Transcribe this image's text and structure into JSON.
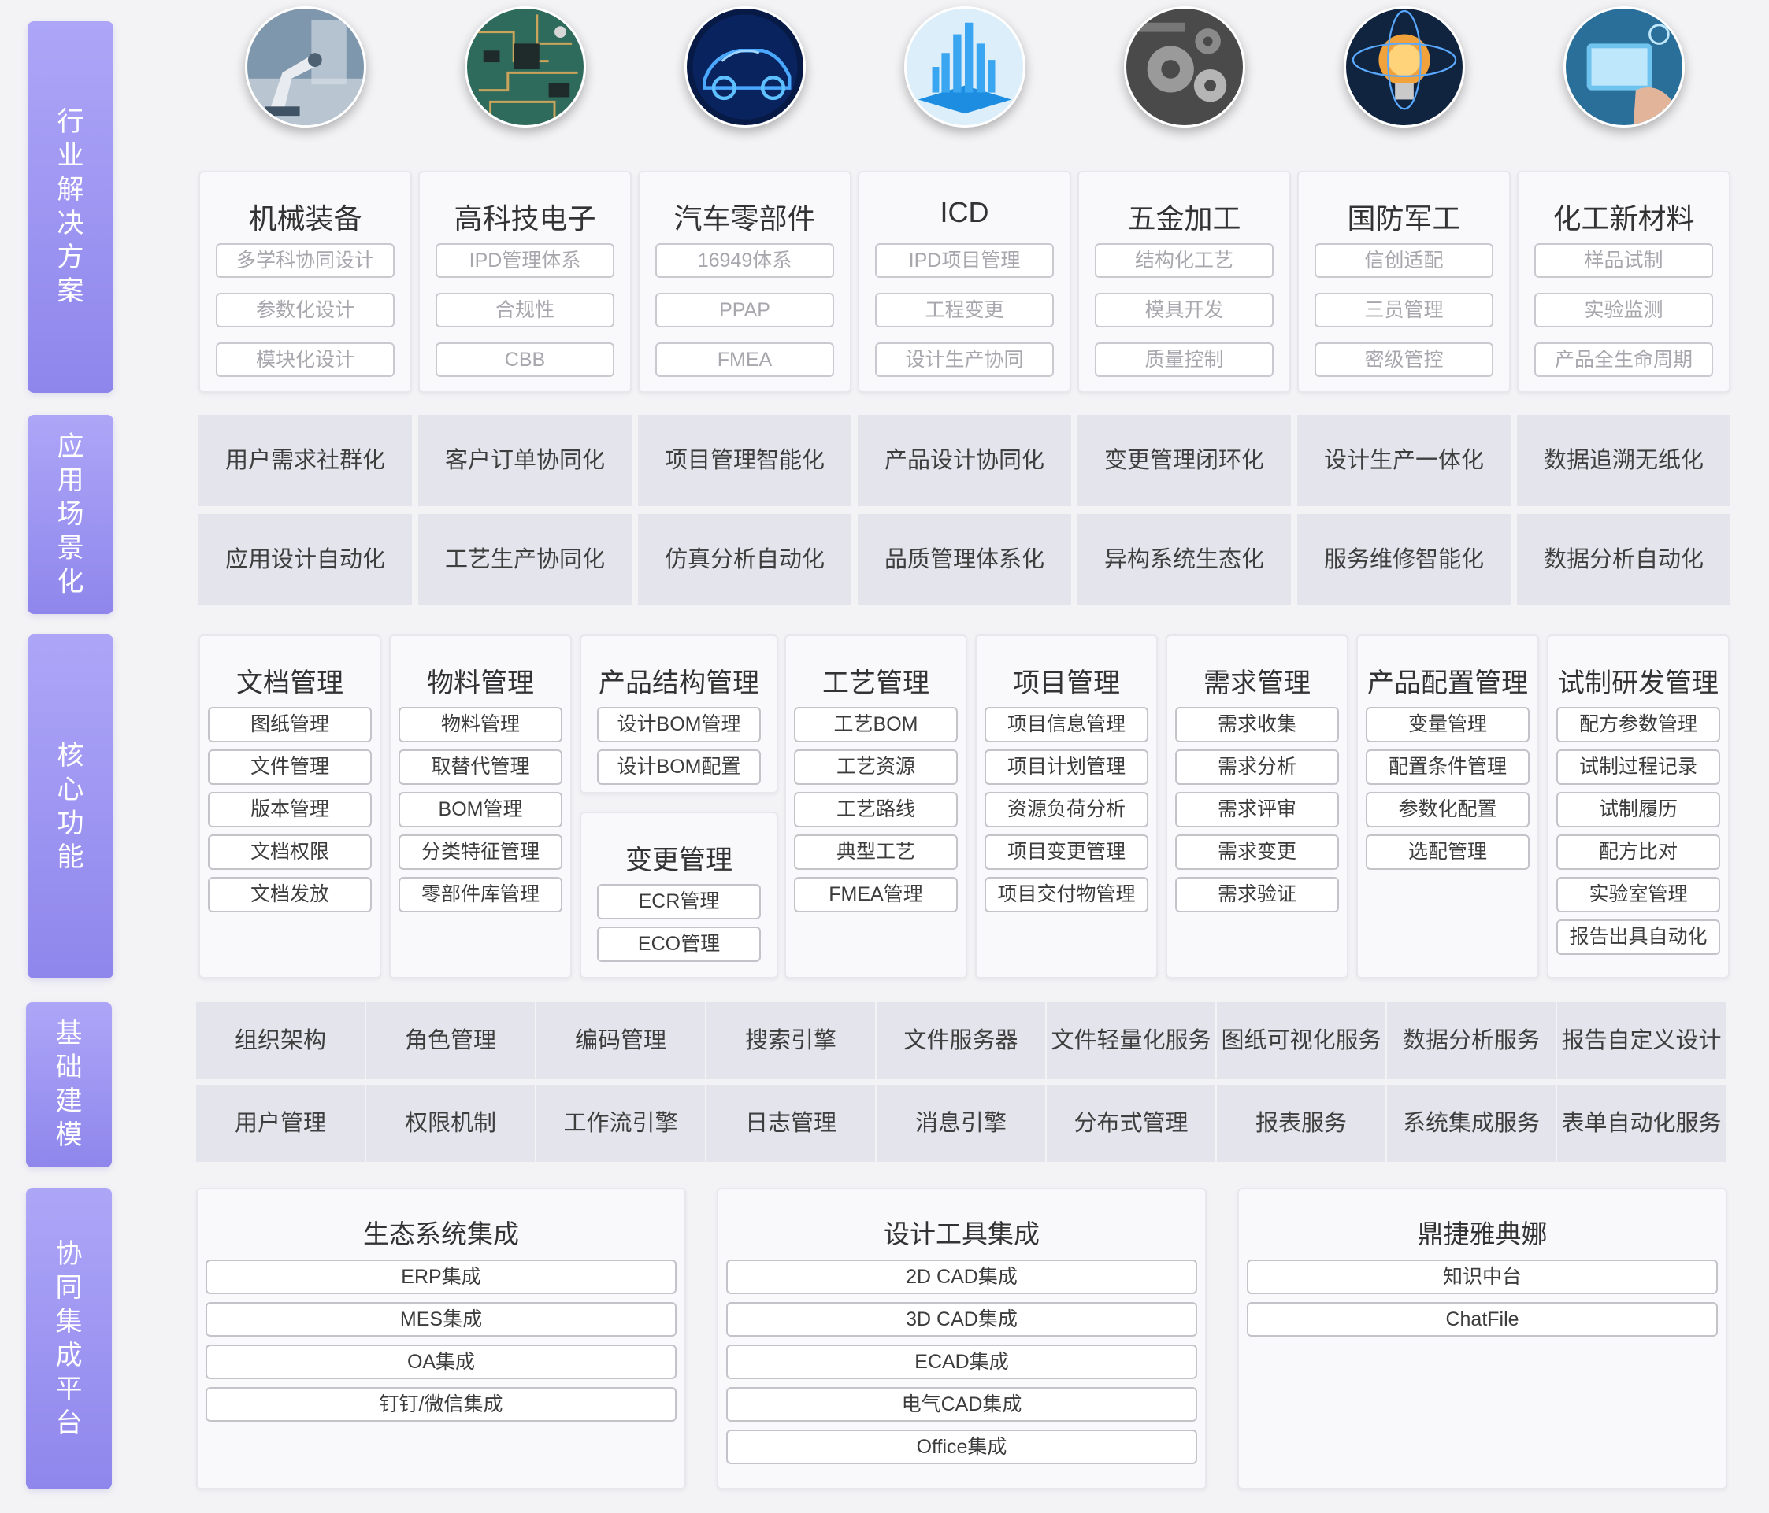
{
  "sections": {
    "industry": [
      "行",
      "业",
      "解",
      "决",
      "方",
      "案"
    ],
    "scenario": [
      "应",
      "用",
      "场",
      "景",
      "化"
    ],
    "core": [
      "核",
      "心",
      "功",
      "能"
    ],
    "foundation": [
      "基",
      "础",
      "建",
      "模"
    ],
    "integration": [
      "协",
      "同",
      "集",
      "成",
      "平",
      "台"
    ]
  },
  "industries": [
    {
      "icon": "robot-arm-icon",
      "title": "机械装备",
      "tags": [
        "多学科协同设计",
        "参数化设计",
        "模块化设计"
      ]
    },
    {
      "icon": "circuit-board-icon",
      "title": "高科技电子",
      "tags": [
        "IPD管理体系",
        "合规性",
        "CBB"
      ]
    },
    {
      "icon": "car-icon",
      "title": "汽车零部件",
      "tags": [
        "16949体系",
        "PPAP",
        "FMEA"
      ]
    },
    {
      "icon": "chip-city-icon",
      "title": "ICD",
      "tags": [
        "IPD项目管理",
        "工程变更",
        "设计生产协同"
      ]
    },
    {
      "icon": "gears-icon",
      "title": "五金加工",
      "tags": [
        "结构化工艺",
        "模具开发",
        "质量控制"
      ]
    },
    {
      "icon": "light-bulb-brain-icon",
      "title": "国防军工",
      "tags": [
        "信创适配",
        "三员管理",
        "密级管控"
      ]
    },
    {
      "icon": "tablet-hand-icon",
      "title": "化工新材料",
      "tags": [
        "样品试制",
        "实验监测",
        "产品全生命周期"
      ]
    }
  ],
  "scenarios": {
    "row1": [
      "用户需求社群化",
      "客户订单协同化",
      "项目管理智能化",
      "产品设计协同化",
      "变更管理闭环化",
      "设计生产一体化",
      "数据追溯无纸化"
    ],
    "row2": [
      "应用设计自动化",
      "工艺生产协同化",
      "仿真分析自动化",
      "品质管理体系化",
      "异构系统生态化",
      "服务维修智能化",
      "数据分析自动化"
    ]
  },
  "core": {
    "doc": {
      "title": "文档管理",
      "items": [
        "图纸管理",
        "文件管理",
        "版本管理",
        "文档权限",
        "文档发放"
      ]
    },
    "material": {
      "title": "物料管理",
      "items": [
        "物料管理",
        "取替代管理",
        "BOM管理",
        "分类特征管理",
        "零部件库管理"
      ]
    },
    "structure": {
      "title": "产品结构管理",
      "items": [
        "设计BOM管理",
        "设计BOM配置"
      ]
    },
    "change": {
      "title": "变更管理",
      "items": [
        "ECR管理",
        "ECO管理"
      ]
    },
    "process": {
      "title": "工艺管理",
      "items": [
        "工艺BOM",
        "工艺资源",
        "工艺路线",
        "典型工艺",
        "FMEA管理"
      ]
    },
    "project": {
      "title": "项目管理",
      "items": [
        "项目信息管理",
        "项目计划管理",
        "资源负荷分析",
        "项目变更管理",
        "项目交付物管理"
      ]
    },
    "requirement": {
      "title": "需求管理",
      "items": [
        "需求收集",
        "需求分析",
        "需求评审",
        "需求变更",
        "需求验证"
      ]
    },
    "config": {
      "title": "产品配置管理",
      "items": [
        "变量管理",
        "配置条件管理",
        "参数化配置",
        "选配管理"
      ]
    },
    "trial": {
      "title": "试制研发管理",
      "items": [
        "配方参数管理",
        "试制过程记录",
        "试制履历",
        "配方比对",
        "实验室管理",
        "报告出具自动化"
      ]
    }
  },
  "foundation": {
    "row1": [
      "组织架构",
      "角色管理",
      "编码管理",
      "搜索引擎",
      "文件服务器",
      "文件轻量化服务",
      "图纸可视化服务",
      "数据分析服务",
      "报告自定义设计"
    ],
    "row2": [
      "用户管理",
      "权限机制",
      "工作流引擎",
      "日志管理",
      "消息引擎",
      "分布式管理",
      "报表服务",
      "系统集成服务",
      "表单自动化服务"
    ]
  },
  "integration": [
    {
      "title": "生态系统集成",
      "items": [
        "ERP集成",
        "MES集成",
        "OA集成",
        "钉钉/微信集成"
      ]
    },
    {
      "title": "设计工具集成",
      "items": [
        "2D CAD集成",
        "3D CAD集成",
        "ECAD集成",
        "电气CAD集成",
        "Office集成"
      ]
    },
    {
      "title": "鼎捷雅典娜",
      "items": [
        "知识中台",
        "ChatFile"
      ]
    }
  ],
  "colors": {
    "accent": "#9a92f2",
    "cell": "#e4e4ec",
    "background": "#f3f3f5"
  }
}
